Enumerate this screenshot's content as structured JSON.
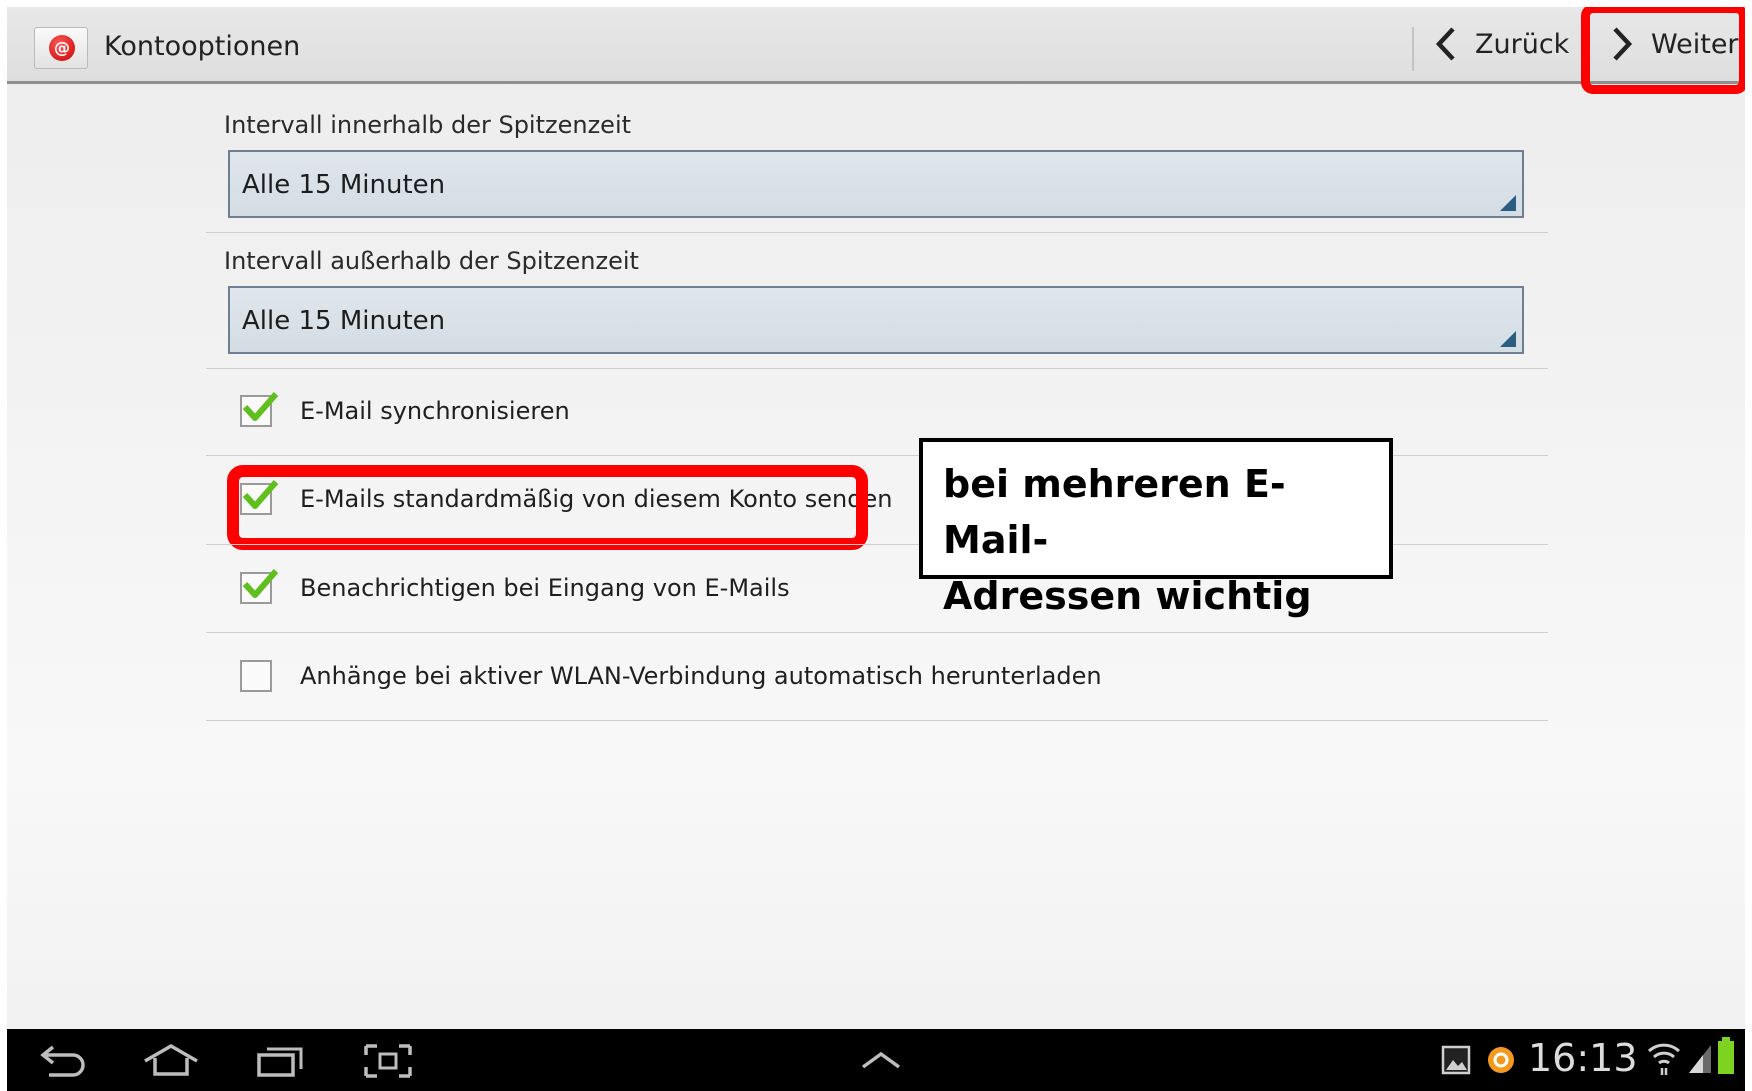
{
  "actionbar": {
    "title": "Kontooptionen",
    "app_icon": "email-app-icon",
    "back_label": "Zurück",
    "next_label": "Weiter"
  },
  "settings": {
    "peak_label": "Intervall innerhalb der Spitzenzeit",
    "peak_value": "Alle 15 Minuten",
    "offpeak_label": "Intervall außerhalb der Spitzenzeit",
    "offpeak_value": "Alle 15 Minuten",
    "checkboxes": [
      {
        "label": "E-Mail synchronisieren",
        "checked": true
      },
      {
        "label": "E-Mails standardmäßig von diesem Konto senden",
        "checked": true
      },
      {
        "label": "Benachrichtigen bei Eingang von E-Mails",
        "checked": true
      },
      {
        "label": "Anhänge bei aktiver WLAN-Verbindung automatisch herunterladen",
        "checked": false
      }
    ]
  },
  "annotation": {
    "line1": "bei mehreren E-Mail-",
    "line2": "Adressen wichtig",
    "highlight_color": "#ff0000"
  },
  "statusbar": {
    "time": "16:13",
    "icons": [
      "back-icon",
      "home-icon",
      "recent-apps-icon",
      "screenshot-icon",
      "up-arrow-icon",
      "gallery-icon",
      "notification-icon",
      "wifi-icon",
      "signal-icon",
      "battery-icon"
    ]
  },
  "colors": {
    "accent": "#2b5d80",
    "check_green": "#5fbf1e",
    "annotation_red": "#ff0000"
  }
}
